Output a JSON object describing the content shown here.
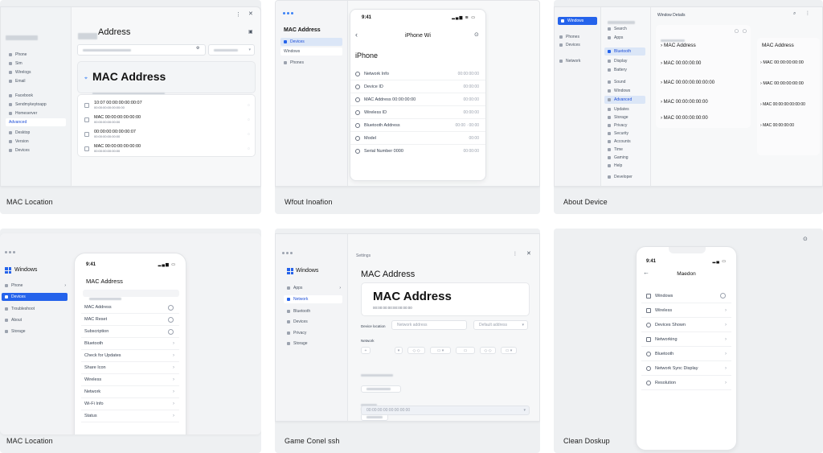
{
  "cards": [
    {
      "caption": "MAC Location",
      "title": "Address",
      "header_title": "MAC Address",
      "list": [
        {
          "label": "10:07 00:00:00:00:00:07",
          "sub": "00:00:00:00:00:00:00"
        },
        {
          "label": "MAC 00:00:00:00:00:00",
          "sub": "00:00:00:00:00:00"
        },
        {
          "label": "00:00:00:00:00:00:07",
          "sub": "00:00:00:00:00:00"
        },
        {
          "label": "MAC 00:00:00:00:00:00",
          "sub": "00:00:00:00:00:00"
        }
      ],
      "sidebar": [
        "Phone",
        "Sim",
        "Wirelogs",
        "Email",
        "Facebook",
        "Sendmykeytoapp",
        "Homeserver",
        "Advanced",
        "Desktop",
        "Version",
        "Devices"
      ]
    },
    {
      "caption": "Wfout Inoafion",
      "sidebar_title": "MAC Address",
      "sidebar": [
        "Devices",
        "Windows",
        "Phones"
      ],
      "status_time": "9:41",
      "nav_title": "iPhone Wi",
      "section": "iPhone",
      "rows": [
        {
          "label": "Network Info",
          "value": "00:00:00:00"
        },
        {
          "label": "Device ID",
          "value": "00:00:00"
        },
        {
          "label": "MAC Address 00:00:00:00",
          "value": "00:00:00"
        },
        {
          "label": "Wireless ID",
          "value": "00:00:00"
        },
        {
          "label": "Bluetooth Address",
          "value": "00:00 · 00:00"
        },
        {
          "label": "Model",
          "value": "00:00"
        },
        {
          "label": "Serial Number 0000",
          "value": "00:00:00"
        }
      ]
    },
    {
      "caption": "About Device",
      "sidebar_active": "Windows",
      "header": "Window Details",
      "list_title": "MAC Address",
      "items": [
        "MAC Address",
        "MAC 00:00:00:00",
        "MAC 00:00:00:00:00:00",
        "MAC 00:00:00:00:00",
        "MAC 00:00:00:00:00"
      ],
      "right_title": "MAC Address",
      "right_items": [
        "MAC 00:00:00:00:00",
        "MAC 00:00:00:00:00",
        "MAC 00:00:00:00:00:00",
        "MAC 00:00:00:00"
      ],
      "sidebar": [
        "Phones",
        "Devices",
        "Network",
        "Search",
        "Apps",
        "Bluetooth",
        "Display",
        "Battery",
        "Sound",
        "Windows",
        "Advanced",
        "Updates",
        "Storage",
        "Privacy",
        "Security",
        "Accounts",
        "Time",
        "Gaming",
        "Help",
        "Developer"
      ]
    },
    {
      "caption": "MAC Location",
      "sidebar_title": "Windows",
      "sidebar": [
        "Phone",
        "Devices",
        "Troubleshoot",
        "About",
        "Storage"
      ],
      "status_time": "9:41",
      "phone_title": "MAC Address",
      "rows": [
        "MAC Address",
        "MAC Reset",
        "Subscription",
        "Bluetooth",
        "Check for Updates",
        "Share Icon",
        "Wireless",
        "Network",
        "Wi-Fi Info",
        "Status"
      ]
    },
    {
      "caption": "Game Conel ssh",
      "sidebar_title": "Windows",
      "sidebar": [
        "Apps",
        "Network",
        "Bluetooth",
        "Devices",
        "Privacy",
        "Storage"
      ],
      "tab": "Settings",
      "title": "MAC Address",
      "big_title": "MAC Address",
      "big_sub": "00:00:00:00:00:00:00:00",
      "field_label": "Device location",
      "field_value": "Network address",
      "select_value": "Default address",
      "section": "Network",
      "dropdown_value": "00:00:00:00:00:00:00:00"
    },
    {
      "caption": "Clean Doskup",
      "status_time": "9:41",
      "nav_title": "Maedon",
      "rows": [
        "Windows",
        "Wireless",
        "Devices Shown",
        "Networking",
        "Bluetooth",
        "Network Sync Display",
        "Resolution"
      ]
    }
  ]
}
